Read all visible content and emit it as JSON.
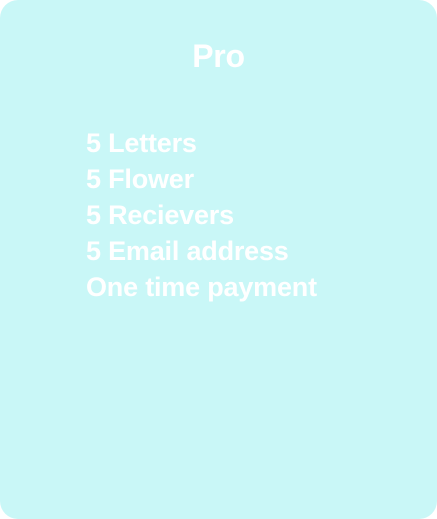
{
  "plan": {
    "title": "Pro",
    "features": [
      "5 Letters",
      "5 Flower",
      "5 Recievers",
      "5 Email address",
      "One time payment"
    ]
  },
  "colors": {
    "card_background": "#c9f7f7",
    "text": "#ffffff"
  }
}
